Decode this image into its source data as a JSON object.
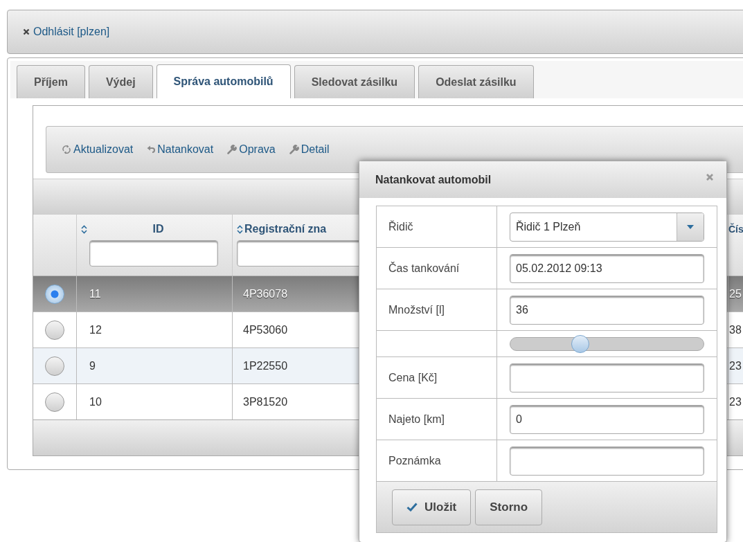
{
  "logout": {
    "label": "Odhlásit [plzen]"
  },
  "tabs": [
    {
      "label": "Příjem",
      "selected": false
    },
    {
      "label": "Výdej",
      "selected": false
    },
    {
      "label": "Správa automobilů",
      "selected": true
    },
    {
      "label": "Sledovat zásilku",
      "selected": false
    },
    {
      "label": "Odeslat zásilku",
      "selected": false
    }
  ],
  "toolbar": [
    {
      "label": "Aktualizovat",
      "kind": "refresh"
    },
    {
      "label": "Natankovat",
      "kind": "undo"
    },
    {
      "label": "Oprava",
      "kind": "wrench"
    },
    {
      "label": "Detail",
      "kind": "wrench"
    }
  ],
  "table": {
    "columns": [
      {
        "label": "ID",
        "sortable": true,
        "filter": true
      },
      {
        "label": "Registrační zna",
        "sortable": true,
        "filter": true
      },
      {
        "label": "Čís",
        "sortable": false,
        "filter": false
      }
    ],
    "rows": [
      {
        "selected": true,
        "cells": [
          "11",
          "4P36078",
          "25"
        ]
      },
      {
        "selected": false,
        "cells": [
          "12",
          "4P53060",
          "38"
        ]
      },
      {
        "selected": false,
        "cells": [
          "9",
          "1P22550",
          "23"
        ]
      },
      {
        "selected": false,
        "cells": [
          "10",
          "3P81520",
          "23"
        ]
      }
    ]
  },
  "dialog": {
    "title": "Natankovat automobil",
    "fields": [
      {
        "kind": "select",
        "label": "Řidič",
        "value": "Řidič 1 Plzeň"
      },
      {
        "kind": "text",
        "label": "Čas tankování",
        "value": "05.02.2012 09:13"
      },
      {
        "kind": "text",
        "label": "Množství [l]",
        "value": "36"
      },
      {
        "kind": "slider",
        "level": 0.36
      },
      {
        "kind": "text",
        "label": "Cena [Kč]"
      },
      {
        "kind": "text",
        "label": "Najeto [km]",
        "value": "0"
      },
      {
        "kind": "text",
        "label": "Poznámka"
      }
    ],
    "buttons": [
      {
        "label": "Uložit",
        "kind": "primary"
      },
      {
        "label": "Storno",
        "kind": "plain"
      }
    ]
  }
}
